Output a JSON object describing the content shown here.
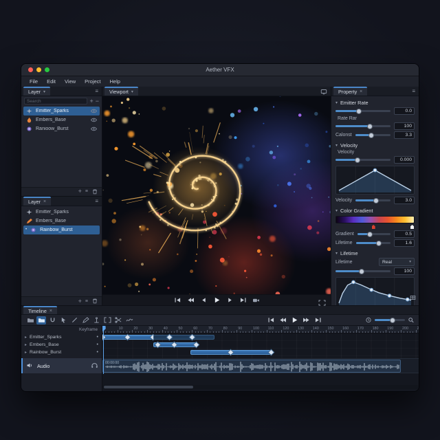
{
  "window": {
    "title": "Aether VFX"
  },
  "menubar": {
    "items": [
      "File",
      "Edit",
      "View",
      "Project",
      "Help"
    ]
  },
  "colors": {
    "accent": "#4a86c8",
    "selection": "#2e5f94",
    "slider_fill": "#4e8cc9",
    "close_light": "#ff5f57",
    "min_light": "#febc2e",
    "zoom_light": "#28c840"
  },
  "layer_panel_top": {
    "tab": "Layer",
    "search_placeholder": "Search",
    "items": [
      {
        "label": "Emitter_Sparks",
        "icon": "sparkle-icon",
        "selected": true
      },
      {
        "label": "Embers_Base",
        "icon": "flame-icon",
        "selected": false
      },
      {
        "label": "Ranioow_Burst",
        "icon": "burst-icon",
        "selected": false
      }
    ]
  },
  "layer_panel_bottom": {
    "tab": "Layer",
    "items": [
      {
        "label": "Emitter_Sparks",
        "icon": "sparkle-icon",
        "selected": false
      },
      {
        "label": "Embers_Base",
        "icon": "pen-orange-icon",
        "selected": false
      },
      {
        "label": "Rainbow_Burst",
        "icon": "burst-icon",
        "selected": true
      }
    ]
  },
  "viewport": {
    "tab": "Viewport",
    "transport": [
      "jump-start",
      "fast-rewind",
      "step-back",
      "play",
      "step-forward",
      "jump-end",
      "camera"
    ]
  },
  "property_panel": {
    "tab": "Property",
    "emitter_rate": {
      "title": "Emitter Rate",
      "rate": {
        "value": "0.0",
        "pct": 42
      },
      "rate_bar": {
        "label": "Rate Rar",
        "value": "100",
        "pct": 62
      },
      "calonst": {
        "label": "Calonst",
        "value": "3.3",
        "pct": 45
      }
    },
    "velocity": {
      "title": "Velocity",
      "velocity_a": {
        "label": "Velocity",
        "value": "0.000",
        "pct": 40
      },
      "curve": {
        "points": [
          [
            0,
            0.03
          ],
          [
            0.5,
            0.95
          ],
          [
            1,
            0.03
          ]
        ],
        "dots": [
          [
            0.5,
            0.95
          ]
        ],
        "fill": true
      },
      "velocity_b": {
        "label": "Velocity",
        "value": "3.0",
        "pct": 58
      }
    },
    "color_gradient": {
      "title": "Color Gradient",
      "gradient": "linear-gradient(90deg,#0d0414,#2a1060,#5a2ec0,#4f5ad8,#9550b0,#c84550,#e8542e,#f58a1e,#ffc133,#ffeeb0)",
      "stops": [
        {
          "pos": 3,
          "color": "#23242c"
        },
        {
          "pos": 48,
          "color": "#d8402f"
        },
        {
          "pos": 97,
          "color": "#f2f3f5"
        }
      ],
      "gradient_slider": {
        "label": "Gradient",
        "value": "0.5",
        "pct": 38
      },
      "lifetime_slider": {
        "label": "Lifetime",
        "value": "1.6",
        "pct": 66
      }
    },
    "lifetime": {
      "title": "Lifetime",
      "mode": {
        "label": "Lifetime",
        "value": "Real"
      },
      "amount": {
        "value": "100",
        "pct": 48
      },
      "curve": {
        "points": [
          [
            0,
            0.03
          ],
          [
            0.05,
            0.45
          ],
          [
            0.12,
            0.8
          ],
          [
            0.2,
            0.93
          ],
          [
            0.3,
            0.82
          ],
          [
            0.42,
            0.65
          ],
          [
            0.55,
            0.48
          ],
          [
            0.7,
            0.35
          ],
          [
            0.85,
            0.24
          ],
          [
            1,
            0.16
          ]
        ],
        "dots": [
          [
            0.2,
            0.93
          ],
          [
            0.45,
            0.6
          ],
          [
            0.7,
            0.35
          ],
          [
            0.95,
            0.19
          ]
        ],
        "fill": true
      }
    }
  },
  "timeline": {
    "tab": "Timeline",
    "tools": [
      "folder",
      "folder-open",
      "magnet",
      "cursor",
      "slash",
      "pen",
      "anchor",
      "frame",
      "scissors",
      "wave"
    ],
    "active_tool": 1,
    "transport": [
      "jump-start",
      "fast-rewind",
      "play",
      "fast-forward",
      "jump-end"
    ],
    "zoom_pct": 60,
    "keyframe_label": "Keyframe",
    "ruler": {
      "start": 0,
      "end": 210,
      "label_step": 10
    },
    "tracks": [
      {
        "name": "Emitter_Sparks",
        "clips": [
          {
            "start": 0,
            "end": 34,
            "keyframes": [
              0,
              17,
              34
            ]
          },
          {
            "start": 34,
            "end": 75,
            "dim": true,
            "keyframes": [
              45,
              60
            ]
          }
        ]
      },
      {
        "name": "Embers_Base",
        "clips": [
          {
            "start": 34,
            "end": 63,
            "keyframes": [
              37,
              48,
              63
            ]
          }
        ]
      },
      {
        "name": "Rainbow_Burst",
        "clips": [
          {
            "start": 59,
            "end": 113,
            "keyframes": [
              86,
              113
            ]
          }
        ]
      }
    ],
    "audio": {
      "name": "Audio",
      "clip_label": "00:00:00",
      "start": 0,
      "end": 200
    },
    "playhead": 0
  }
}
